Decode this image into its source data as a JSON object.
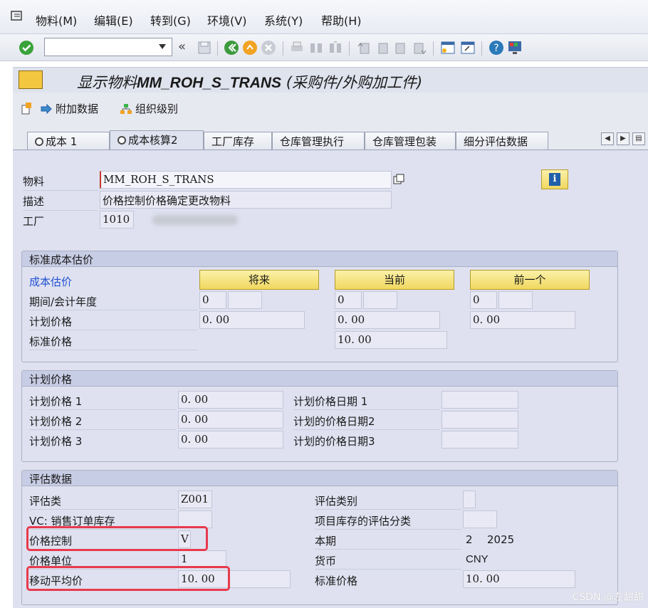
{
  "menubar": {
    "items": [
      "物料(M)",
      "编辑(E)",
      "转到(G)",
      "环境(V)",
      "系统(Y)",
      "帮助(H)"
    ]
  },
  "toolbar": {
    "command_value": "",
    "back_glyph": "«"
  },
  "title": {
    "prefix": "显示物料",
    "material": "MM_ROH_S_TRANS",
    "suffix": " (采购件/外购加工件)"
  },
  "app_toolbar": {
    "additional_data": "附加数据",
    "org_levels": "组织级别"
  },
  "tabs": [
    "成本 1",
    "成本核算2",
    "工厂库存",
    "仓库管理执行",
    "仓库管理包装",
    "细分评估数据"
  ],
  "header": {
    "material_label": "物料",
    "material_value": "MM_ROH_S_TRANS",
    "desc_label": "描述",
    "desc_value": "价格控制价格确定更改物料",
    "plant_label": "工厂",
    "plant_value": "1010"
  },
  "std_cost": {
    "title": "标准成本估价",
    "cost_estimate_label": "成本估价",
    "future_btn": "将来",
    "current_btn": "当前",
    "previous_btn": "前一个",
    "period_label": "期间/会计年度",
    "future_period": "0",
    "current_period": "0",
    "previous_period": "0",
    "plan_price_label": "计划价格",
    "future_plan": "0. 00",
    "current_plan": "0. 00",
    "previous_plan": "0. 00",
    "std_price_label": "标准价格",
    "current_std": "10. 00"
  },
  "planned": {
    "title": "计划价格",
    "p1_label": "计划价格 1",
    "p1_value": "0. 00",
    "p2_label": "计划价格 2",
    "p2_value": "0. 00",
    "p3_label": "计划价格 3",
    "p3_value": "0. 00",
    "d1_label": "计划价格日期 1",
    "d2_label": "计划的价格日期2",
    "d3_label": "计划的价格日期3"
  },
  "valuation": {
    "title": "评估数据",
    "class_label": "评估类",
    "class_value": "Z001",
    "vc_label": "VC: 销售订单库存",
    "price_control_label": "价格控制",
    "price_control_value": "V",
    "price_unit_label": "价格单位",
    "price_unit_value": "1",
    "map_label": "移动平均价",
    "map_value": "10. 00",
    "category_label": "评估类别",
    "project_label": "项目库存的评估分类",
    "period_label": "本期",
    "period_value": "2",
    "year_value": "2025",
    "currency_label": "货币",
    "currency_value": "CNY",
    "std_label": "标准价格",
    "std_value": "10. 00"
  },
  "watermark": "CSDN @左甜甜",
  "colors": {
    "highlight": "#e83a4d",
    "panel": "#dfe1f0",
    "button_yellow": "#f0d85f"
  }
}
